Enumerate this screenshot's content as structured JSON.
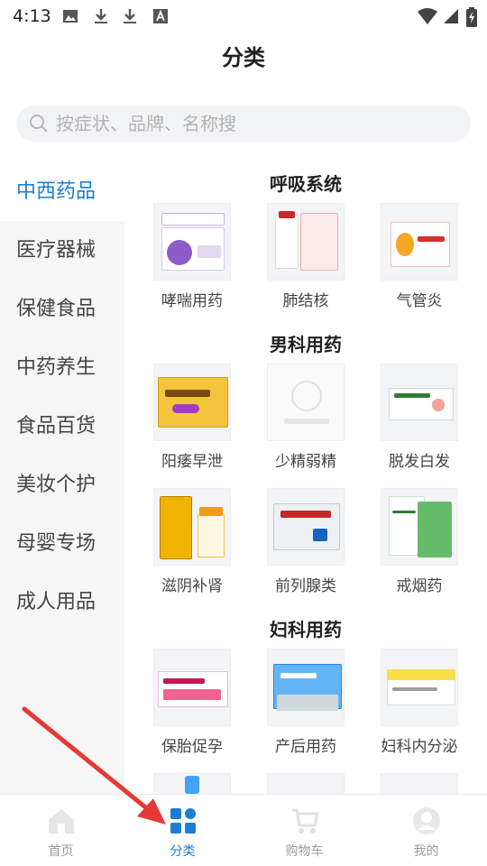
{
  "status_bar": {
    "time": "4:13",
    "icons": [
      "image-icon",
      "download-icon",
      "download-icon",
      "font-a-icon"
    ],
    "right_icons": [
      "wifi-icon",
      "signal-icon",
      "battery-charging-icon"
    ]
  },
  "header": {
    "title": "分类"
  },
  "search": {
    "placeholder": "按症状、品牌、名称搜"
  },
  "categories": [
    {
      "label": "中西药品",
      "active": true
    },
    {
      "label": "医疗器械"
    },
    {
      "label": "保健食品"
    },
    {
      "label": "中药养生"
    },
    {
      "label": "食品百货"
    },
    {
      "label": "美妆个护"
    },
    {
      "label": "母婴专场"
    },
    {
      "label": "成人用品"
    }
  ],
  "sections": [
    {
      "title": "呼吸系统",
      "items": [
        "哮喘用药",
        "肺结核",
        "气管炎"
      ]
    },
    {
      "title": "男科用药",
      "items": [
        "阳痿早泄",
        "少精弱精",
        "脱发白发",
        "滋阴补肾",
        "前列腺类",
        "戒烟药"
      ]
    },
    {
      "title": "妇科用药",
      "items": [
        "保胎促孕",
        "产后用药",
        "妇科内分泌"
      ]
    }
  ],
  "tab_bar": {
    "tabs": [
      {
        "label": "首页",
        "icon": "home-icon"
      },
      {
        "label": "分类",
        "icon": "category-grid-icon",
        "active": true
      },
      {
        "label": "购物车",
        "icon": "cart-icon"
      },
      {
        "label": "我的",
        "icon": "profile-icon"
      }
    ]
  },
  "colors": {
    "accent": "#1a7fd4",
    "arrow": "#e53935",
    "nav_bg": "#f6f6f6"
  }
}
